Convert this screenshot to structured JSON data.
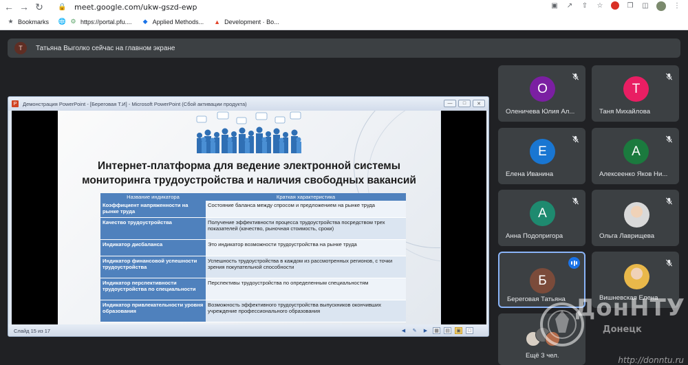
{
  "browser": {
    "url": "meet.google.com/ukw-gszd-ewp",
    "bookmarks": [
      {
        "label": "Bookmarks",
        "icon": "star-icon"
      },
      {
        "label": "https://portal.pfu....",
        "icon": "globe-icon"
      },
      {
        "label": "Applied Methods...",
        "icon": "diamond-icon"
      },
      {
        "label": "Development · Bo...",
        "icon": "gitlab-icon"
      }
    ]
  },
  "notification": {
    "avatar_letter": "Т",
    "text": "Татьяна Выголко сейчас на главном экране"
  },
  "presentation": {
    "window_title": "Демонстрация PowerPoint - [Береговая Т.И] - Microsoft PowerPoint (Сбой активации продукта)",
    "app_icon_letter": "P",
    "slide_heading_line1": "Интернет-платформа для ведение электронной системы",
    "slide_heading_line2": "мониторинга трудоустройства и наличия свободных вакансий",
    "table": {
      "headers": [
        "Название индикатора",
        "Краткая характеристика"
      ],
      "rows": [
        {
          "name": "Коэффициент напряженности на рынке труда",
          "desc": "Состояние баланса между спросом и предложением на рынке труда"
        },
        {
          "name": "Качество трудоустройства",
          "desc": "Получение эффективности процесса трудоустройства посредством трех показателей (качество, рыночная стоимость, сроки)"
        },
        {
          "name": "Индикатор дисбаланса",
          "desc": "Это индикатор возможности трудоустройства на рынке труда"
        },
        {
          "name": "Индикатор финансовой успешности трудоустройства",
          "desc": "Успешность трудоустройства в каждом из рассмотренных регионов, с точки зрения покупательной способности"
        },
        {
          "name": "Индикатор перспективности трудоустройства по специальности",
          "desc": "Перспективы трудоустройства по определенным специальностям"
        },
        {
          "name": "Индикатор привлекательности уровня образования",
          "desc": "Возможность эффективного трудоустройства выпускников окончивших учреждение профессионального образования"
        }
      ]
    },
    "status_text": "Слайд 15 из 17"
  },
  "participants": [
    {
      "letter": "О",
      "name": "Оленичева Юлия Ал...",
      "color": "#7b1fa2",
      "muted": true
    },
    {
      "letter": "Т",
      "name": "Таня Михайлова",
      "color": "#e91e63",
      "muted": true
    },
    {
      "letter": "Е",
      "name": "Елена Иванина",
      "color": "#1976d2",
      "muted": true
    },
    {
      "letter": "А",
      "name": "Алексеенко Яков Ни...",
      "color": "#1b7a3e",
      "muted": true
    },
    {
      "letter": "А",
      "name": "Анна Подопригора",
      "color": "#1e8a6f",
      "muted": true
    },
    {
      "letter": "",
      "name": "Ольга Лаврищева",
      "color": "#d9d9d9",
      "muted": true,
      "photo": true
    },
    {
      "letter": "Б",
      "name": "Береговая Татьяна",
      "color": "#7b4b3a",
      "muted": false,
      "speaking": true
    },
    {
      "letter": "",
      "name": "Вишневская Елена",
      "color": "#e9b84a",
      "muted": true,
      "photo": true
    },
    {
      "letter": "",
      "name": "Ещё 3 чел.",
      "color": "#8a8a8a",
      "muted": false,
      "more": true
    }
  ],
  "watermark": {
    "title": "ДонНТУ",
    "subtitle": "http://donntu.ru",
    "extra": "Донецк"
  }
}
